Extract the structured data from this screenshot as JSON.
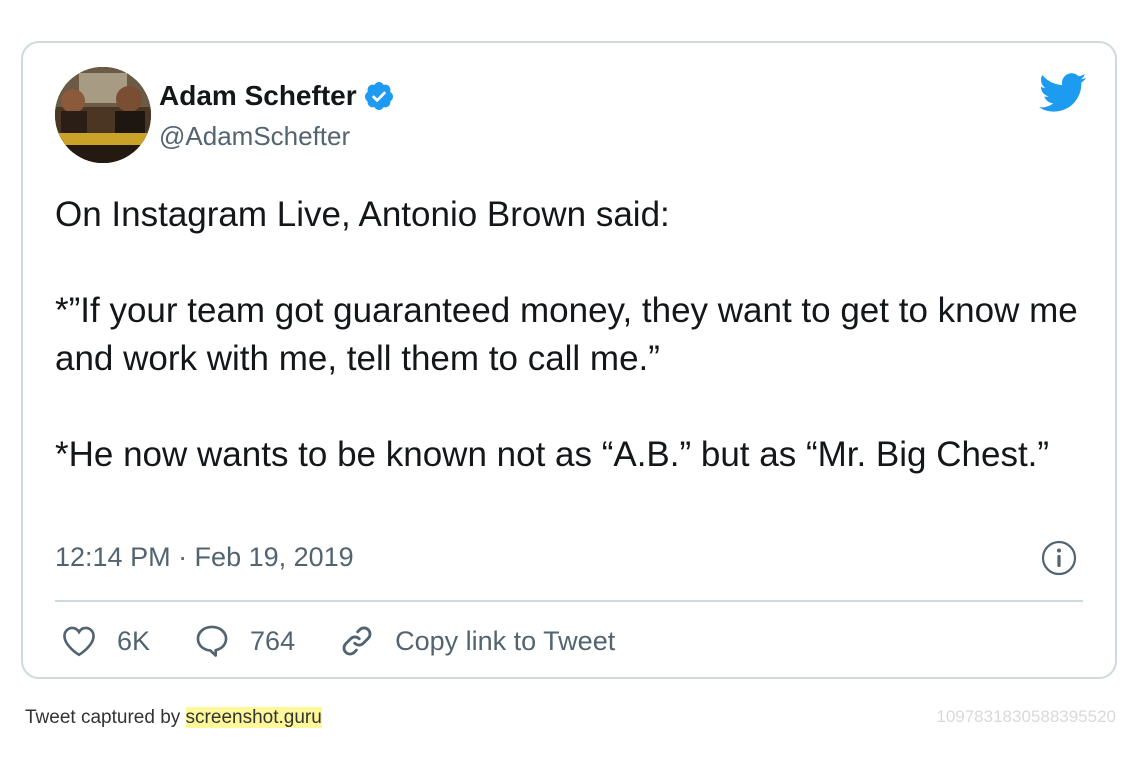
{
  "tweet": {
    "display_name": "Adam Schefter",
    "handle": "@AdamSchefter",
    "verified": true,
    "text_lines": [
      "On Instagram Live, Antonio Brown said:",
      "*”If your team got guaranteed money, they want to get to know me and work with me, tell them to call me.”",
      "*He now wants to be known not as “A.B.” but as “Mr. Big Chest.”"
    ],
    "timestamp": "12:14 PM · Feb 19, 2019",
    "likes": "6K",
    "replies": "764",
    "copy_link_label": "Copy link to Tweet"
  },
  "footer": {
    "captured_by": "Tweet captured by ",
    "site": "screenshot.guru",
    "tweet_id": "1097831830588395520"
  },
  "colors": {
    "twitter_blue": "#1d9bf0",
    "muted_text": "#536471",
    "border": "#cfd9de",
    "highlight": "#fdf89a"
  },
  "icons": {
    "logo": "twitter-bird-icon",
    "verified": "verified-badge-icon",
    "info": "info-icon",
    "like": "heart-icon",
    "reply": "speech-bubble-icon",
    "link": "link-icon"
  }
}
